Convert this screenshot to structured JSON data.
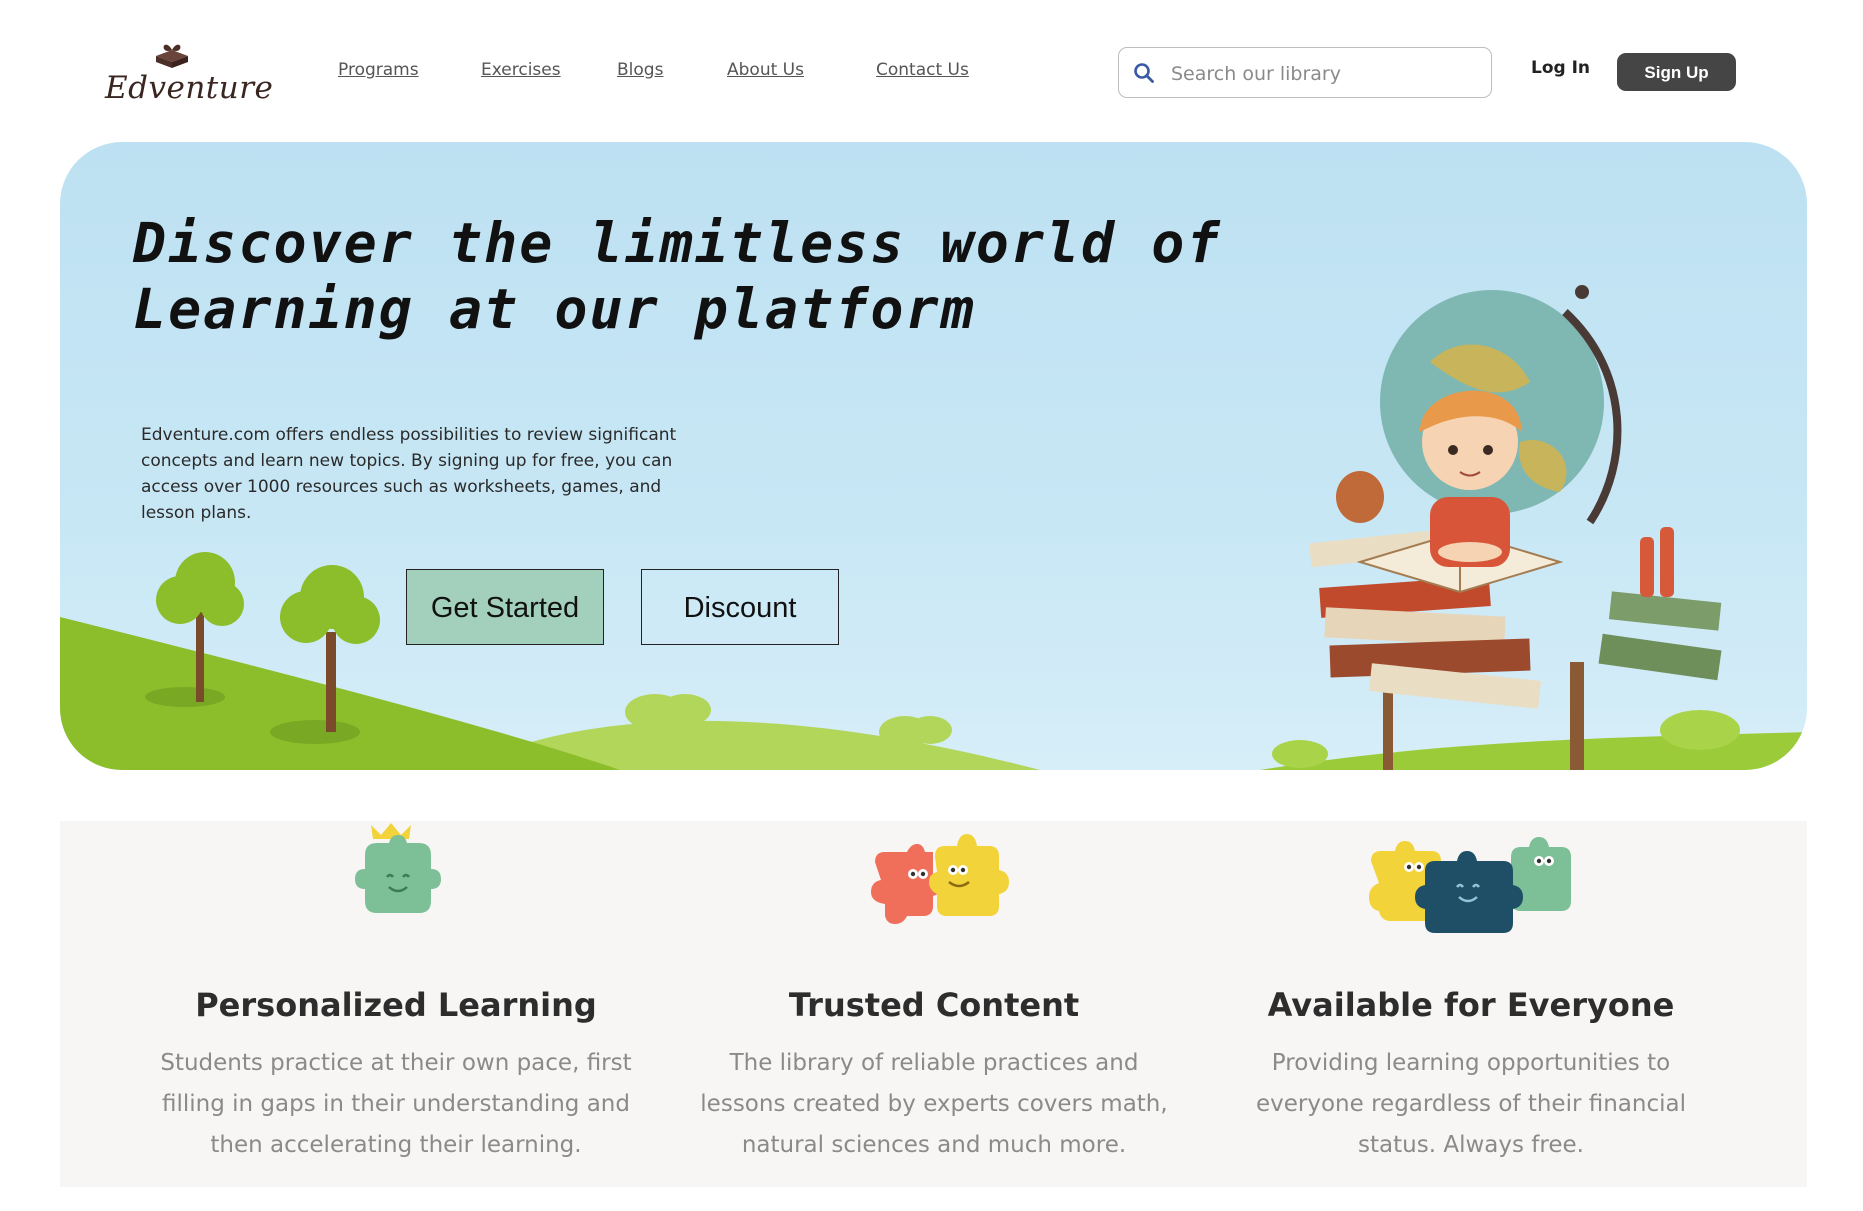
{
  "header": {
    "logo_text": "Edventure",
    "nav": [
      "Programs",
      "Exercises",
      "Blogs",
      "About Us",
      "Contact Us"
    ],
    "search_placeholder": "Search our library",
    "login_label": "Log In",
    "signup_label": "Sign Up"
  },
  "hero": {
    "title_line1": "Discover the limitless world of",
    "title_line2": "Learning at our platform",
    "description": "Edventure.com offers endless possibilities to review significant concepts and learn new topics. By signing up for free, you can access over 1000 resources such as worksheets, games, and lesson plans.",
    "primary_button": "Get Started",
    "secondary_button": "Discount"
  },
  "features": [
    {
      "icon": "puzzle-crown-icon",
      "title": "Personalized Learning",
      "text": "Students practice at their own pace, first filling in gaps in their understanding and then accelerating their learning."
    },
    {
      "icon": "puzzle-pair-icon",
      "title": "Trusted Content",
      "text": "The library of reliable practices and lessons created by experts covers math, natural sciences and much more."
    },
    {
      "icon": "puzzle-group-icon",
      "title": "Available for Everyone",
      "text": "Providing learning opportunities to everyone regardless of their financial status. Always free."
    }
  ],
  "colors": {
    "hero_sky": "#bde1f2",
    "grass": "#8cbd2a",
    "primary_button": "#a2d0bd",
    "signup_button": "#454545",
    "feature_bg": "#f7f6f4"
  }
}
